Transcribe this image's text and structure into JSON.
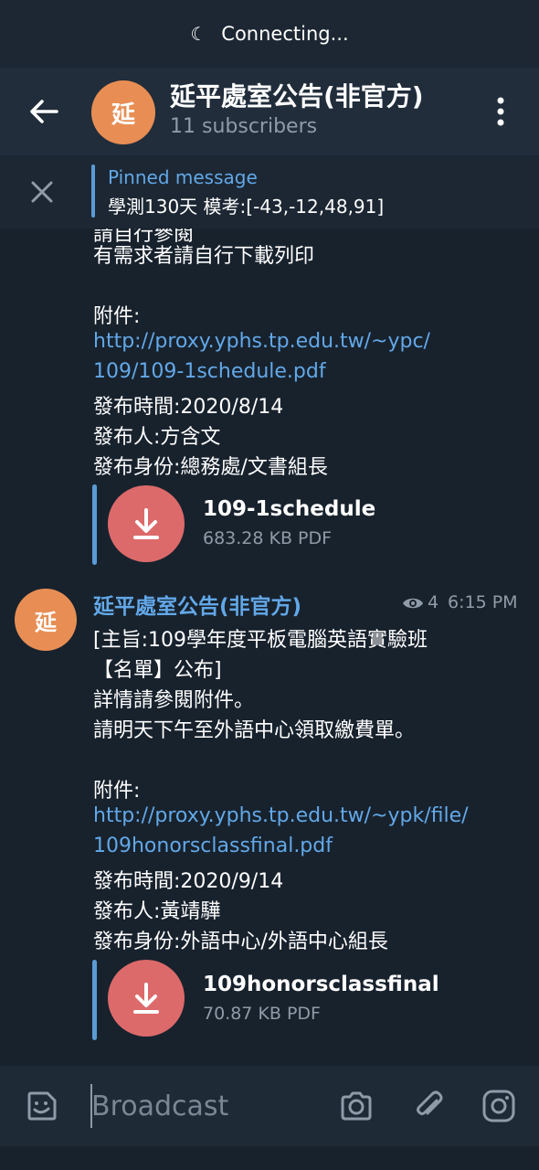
{
  "status": {
    "text": "Connecting..."
  },
  "header": {
    "avatar_letter": "延",
    "title": "延平處室公告(非官方)",
    "subtitle": "11 subscribers"
  },
  "pinned": {
    "label": "Pinned message",
    "text": "學測130天 模考:[-43,-12,48,91]"
  },
  "messages": [
    {
      "lines": [
        "請自行參閱",
        "有需求者請自行下載列印",
        "",
        "附件:"
      ],
      "link": [
        "http://proxy.yphs.tp.edu.tw/~ypc/",
        "109/109-1schedule.pdf"
      ],
      "meta_lines": [
        "發布時間:2020/8/14",
        "發布人:方含文",
        "發布身份:總務處/文書組長"
      ],
      "file": {
        "name": "109-1schedule",
        "meta": "683.28 KB PDF"
      }
    },
    {
      "avatar_letter": "延",
      "sender": "延平處室公告(非官方)",
      "views": "4",
      "time": "6:15 PM",
      "lines": [
        "[主旨:109學年度平板電腦英語實驗班",
        "【名單】公布]",
        "詳情請參閱附件。",
        "請明天下午至外語中心領取繳費單。",
        "",
        "附件:"
      ],
      "link": [
        "http://proxy.yphs.tp.edu.tw/~ypk/file/",
        "109honorsclassfinal.pdf"
      ],
      "meta_lines": [
        "發布時間:2020/9/14",
        "發布人:黃靖驊",
        "發布身份:外語中心/外語中心組長"
      ],
      "file": {
        "name": "109honorsclassfinal",
        "meta": "70.87 KB PDF"
      }
    }
  ],
  "composer": {
    "placeholder": "Broadcast"
  },
  "colors": {
    "background": "#18222d",
    "accent": "#62a8e8",
    "avatar": "#e88e54",
    "file_button": "#dc6a6a"
  },
  "icons": [
    "moon-icon",
    "back-arrow-icon",
    "more-vert-icon",
    "close-icon",
    "download-icon",
    "eye-icon",
    "sticker-icon",
    "camera-icon",
    "attach-icon",
    "instagram-icon"
  ]
}
